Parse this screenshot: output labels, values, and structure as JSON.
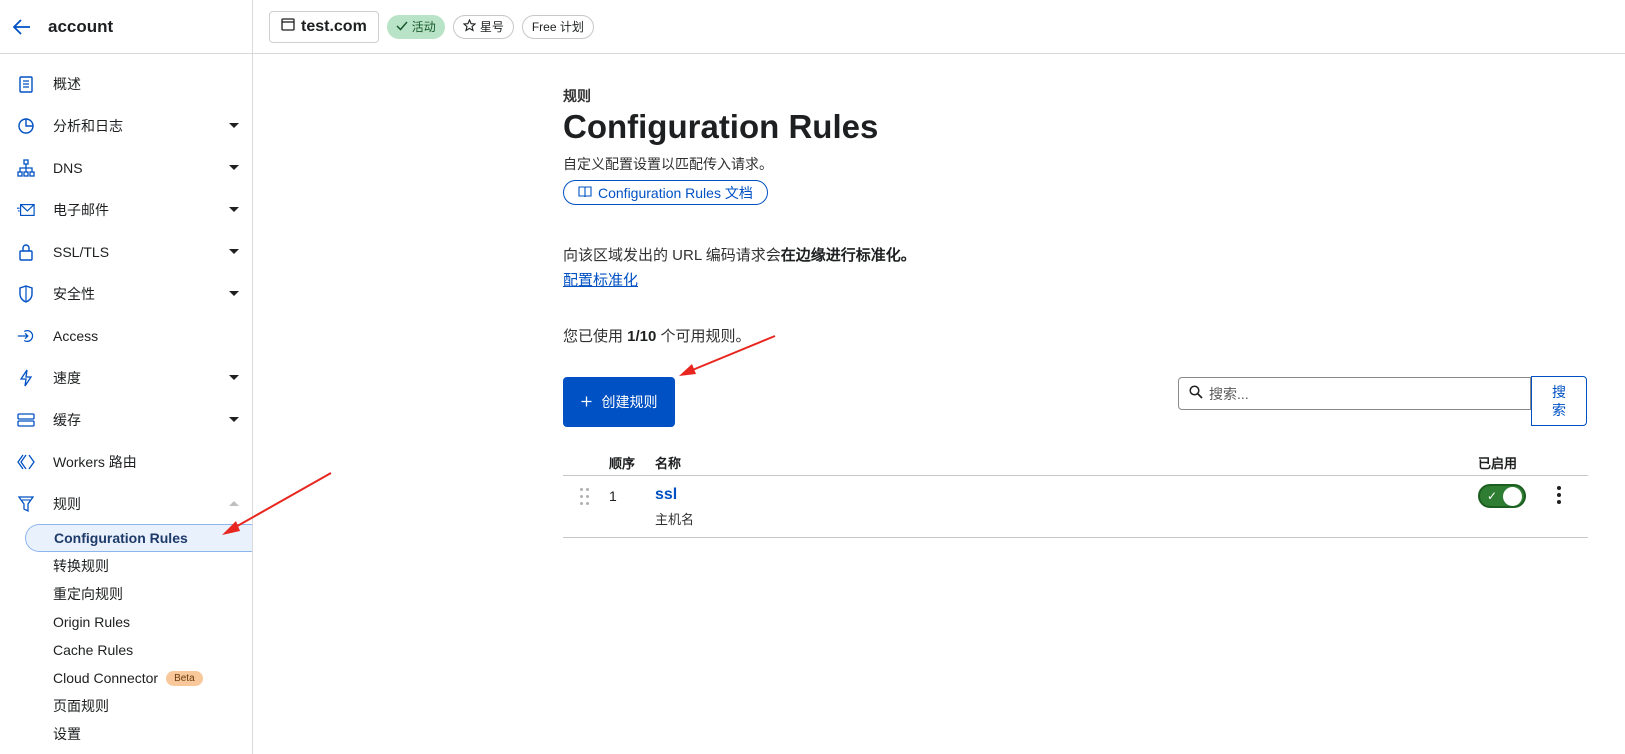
{
  "sidebar": {
    "account_label": "account",
    "items": [
      {
        "label": "概述",
        "icon": "clipboard-icon"
      },
      {
        "label": "分析和日志",
        "icon": "analytics-icon"
      },
      {
        "label": "DNS",
        "icon": "sitemap-icon"
      },
      {
        "label": "电子邮件",
        "icon": "mail-icon"
      },
      {
        "label": "SSL/TLS",
        "icon": "lock-icon"
      },
      {
        "label": "安全性",
        "icon": "shield-icon"
      },
      {
        "label": "Access",
        "icon": "access-icon"
      },
      {
        "label": "速度",
        "icon": "bolt-icon"
      },
      {
        "label": "缓存",
        "icon": "cache-icon"
      },
      {
        "label": "Workers 路由",
        "icon": "workers-icon"
      },
      {
        "label": "规则",
        "icon": "funnel-icon"
      }
    ],
    "sub_items": [
      {
        "label": "Configuration Rules"
      },
      {
        "label": "转换规则"
      },
      {
        "label": "重定向规则"
      },
      {
        "label": "Origin Rules"
      },
      {
        "label": "Cache Rules"
      },
      {
        "label": "Cloud Connector",
        "badge": "Beta"
      },
      {
        "label": "页面规则"
      },
      {
        "label": "设置"
      }
    ]
  },
  "topbar": {
    "domain": "test.com",
    "status": "活动",
    "star": "星号",
    "plan": "Free 计划"
  },
  "main": {
    "eyebrow": "规则",
    "title": "Configuration Rules",
    "description": "自定义配置设置以匹配传入请求。",
    "docs_button": "Configuration Rules 文档",
    "normalize_prefix": "向该区域发出的 URL 编码请求会",
    "normalize_bold": "在边缘进行标准化。",
    "normalize_link": "配置标准化",
    "usage_prefix": "您已使用 ",
    "usage_count": "1/10",
    "usage_suffix": " 个可用规则。",
    "create_button": "创建规则",
    "search_placeholder": "搜索...",
    "search_button": "搜\n索"
  },
  "table": {
    "headers": {
      "order": "顺序",
      "name": "名称",
      "enabled": "已启用"
    },
    "rows": [
      {
        "order": "1",
        "name": "ssl",
        "subtitle": "主机名",
        "enabled": true
      }
    ]
  },
  "colors": {
    "accent": "#0051c3",
    "toggle_on": "#2e7d32",
    "annotation_arrow": "#e8261f"
  }
}
